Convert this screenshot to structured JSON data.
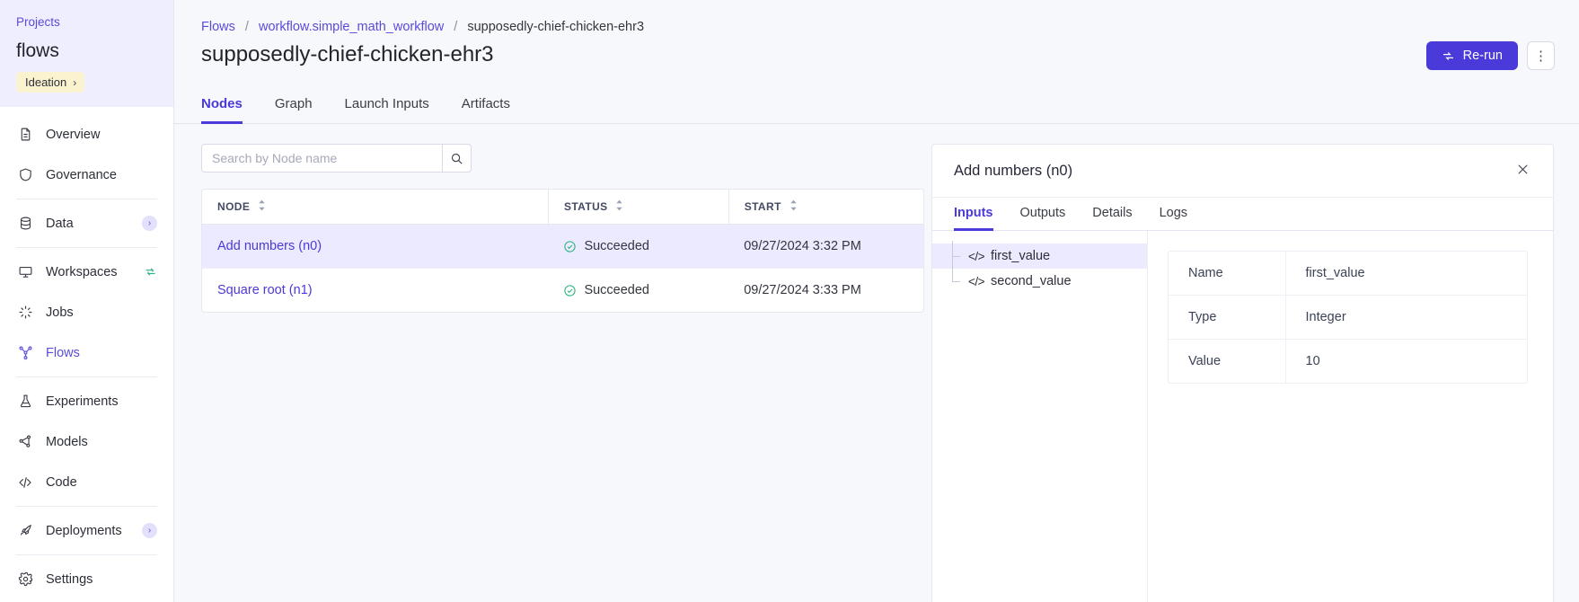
{
  "sidebar": {
    "projects_label": "Projects",
    "project_name": "flows",
    "badge_label": "Ideation",
    "badge_chevron": "›",
    "items": [
      {
        "label": "Overview",
        "icon": "document-icon",
        "active": false,
        "tag": ""
      },
      {
        "label": "Governance",
        "icon": "shield-icon",
        "active": false,
        "tag": ""
      },
      {
        "label": "Data",
        "icon": "database-icon",
        "active": false,
        "tag": "›"
      },
      {
        "label": "Workspaces",
        "icon": "monitor-icon",
        "active": false,
        "tag": ""
      },
      {
        "label": "Jobs",
        "icon": "spinner-icon",
        "active": false,
        "tag": ""
      },
      {
        "label": "Flows",
        "icon": "flow-graph-icon",
        "active": true,
        "tag": ""
      },
      {
        "label": "Experiments",
        "icon": "flask-icon",
        "active": false,
        "tag": ""
      },
      {
        "label": "Models",
        "icon": "model-node-icon",
        "active": false,
        "tag": ""
      },
      {
        "label": "Code",
        "icon": "code-icon",
        "active": false,
        "tag": ""
      },
      {
        "label": "Deployments",
        "icon": "rocket-icon",
        "active": false,
        "tag": "›"
      },
      {
        "label": "Settings",
        "icon": "gear-icon",
        "active": false,
        "tag": ""
      }
    ]
  },
  "header": {
    "breadcrumb": {
      "root": "Flows",
      "workflow": "workflow.simple_math_workflow",
      "current": "supposedly-chief-chicken-ehr3",
      "separator": "/"
    },
    "page_title": "supposedly-chief-chicken-ehr3",
    "rerun_label": "Re-run",
    "kebab_label": "⋮"
  },
  "tabs": [
    {
      "label": "Nodes",
      "active": true
    },
    {
      "label": "Graph",
      "active": false
    },
    {
      "label": "Launch Inputs",
      "active": false
    },
    {
      "label": "Artifacts",
      "active": false
    }
  ],
  "search": {
    "placeholder": "Search by Node name",
    "value": ""
  },
  "nodes_table": {
    "columns": [
      "NODE",
      "STATUS",
      "START"
    ],
    "rows": [
      {
        "node": "Add numbers (n0)",
        "status": "Succeeded",
        "start": "09/27/2024 3:32 PM",
        "selected": true
      },
      {
        "node": "Square root (n1)",
        "status": "Succeeded",
        "start": "09/27/2024 3:33 PM",
        "selected": false
      }
    ]
  },
  "panel": {
    "title": "Add numbers (n0)",
    "close_label": "✕",
    "tabs": [
      {
        "label": "Inputs",
        "active": true
      },
      {
        "label": "Outputs",
        "active": false
      },
      {
        "label": "Details",
        "active": false
      },
      {
        "label": "Logs",
        "active": false
      }
    ],
    "tree": [
      {
        "label": "first_value",
        "selected": true
      },
      {
        "label": "second_value",
        "selected": false
      }
    ],
    "detail": {
      "rows": [
        {
          "key": "Name",
          "value": "first_value"
        },
        {
          "key": "Type",
          "value": "Integer"
        },
        {
          "key": "Value",
          "value": "10"
        }
      ]
    }
  },
  "colors": {
    "accent": "#4a3ad9",
    "link": "#5a4bda",
    "success": "#26b37c",
    "sidebar_head_bg": "#eeeeff",
    "badge_bg": "#fbf3d0",
    "row_selected_bg": "#eceaff",
    "page_bg": "#f7f8fb"
  }
}
